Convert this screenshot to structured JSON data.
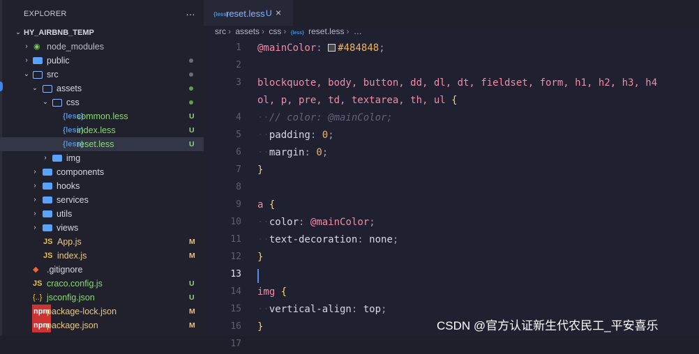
{
  "sidebar": {
    "title": "EXPLORER",
    "more": "…",
    "root": "HY_AIRBNB_TEMP",
    "items": [
      {
        "label": "node_modules",
        "status": ""
      },
      {
        "label": "public",
        "status": ""
      },
      {
        "label": "src",
        "status": ""
      },
      {
        "label": "assets",
        "status": ""
      },
      {
        "label": "css",
        "status": ""
      },
      {
        "label": "common.less",
        "status": "U"
      },
      {
        "label": "index.less",
        "status": "U"
      },
      {
        "label": "reset.less",
        "status": "U"
      },
      {
        "label": "img",
        "status": ""
      },
      {
        "label": "components",
        "status": ""
      },
      {
        "label": "hooks",
        "status": ""
      },
      {
        "label": "services",
        "status": ""
      },
      {
        "label": "utils",
        "status": ""
      },
      {
        "label": "views",
        "status": ""
      },
      {
        "label": "App.js",
        "status": "M"
      },
      {
        "label": "index.js",
        "status": "M"
      },
      {
        "label": ".gitignore",
        "status": ""
      },
      {
        "label": "craco.config.js",
        "status": "U"
      },
      {
        "label": "jsconfig.json",
        "status": "U"
      },
      {
        "label": "package-lock.json",
        "status": "M"
      },
      {
        "label": "package.json",
        "status": "M"
      }
    ]
  },
  "tab": {
    "name": "reset.less",
    "status": "U",
    "close": "×"
  },
  "breadcrumb": [
    "src",
    "assets",
    "css",
    "reset.less",
    "…"
  ],
  "editor": {
    "line_numbers": [
      "1",
      "2",
      "3",
      "4",
      "5",
      "6",
      "7",
      "8",
      "9",
      "10",
      "11",
      "12",
      "13",
      "14",
      "15",
      "16",
      "17"
    ],
    "code": {
      "l1_var": "@mainColor",
      "l1_colon": ":",
      "l1_val": "#484848",
      "l1_semi": ";",
      "l3a": "blockquote, body, button, dd, dl, dt, fieldset, form, h1, h2, h3, h4",
      "l3b": "ol, p, pre, td, textarea, th, ul",
      "l4": "// color: @mainColor;",
      "l5_prop": "padding",
      "l5_val": "0",
      "l6_prop": "margin",
      "l6_val": "0",
      "l9_sel": "a",
      "l10_prop": "color",
      "l10_val": "@mainColor",
      "l11_prop": "text-decoration",
      "l11_val": "none",
      "l14_sel": "img",
      "l15_prop": "vertical-align",
      "l15_val": "top",
      "open": "{",
      "close": "}"
    }
  },
  "watermark": "CSDN @官方认证新生代农民工_平安喜乐",
  "colors": {
    "accent": "#89b6ff",
    "untracked": "#7ccb5a",
    "modified": "#e2c08d",
    "background": "#1f2030"
  },
  "icons": {
    "folder": "folder-icon",
    "less": "less-file-icon",
    "js": "js-file-icon",
    "json": "json-file-icon",
    "git": "git-icon",
    "npm": "npm-icon"
  }
}
